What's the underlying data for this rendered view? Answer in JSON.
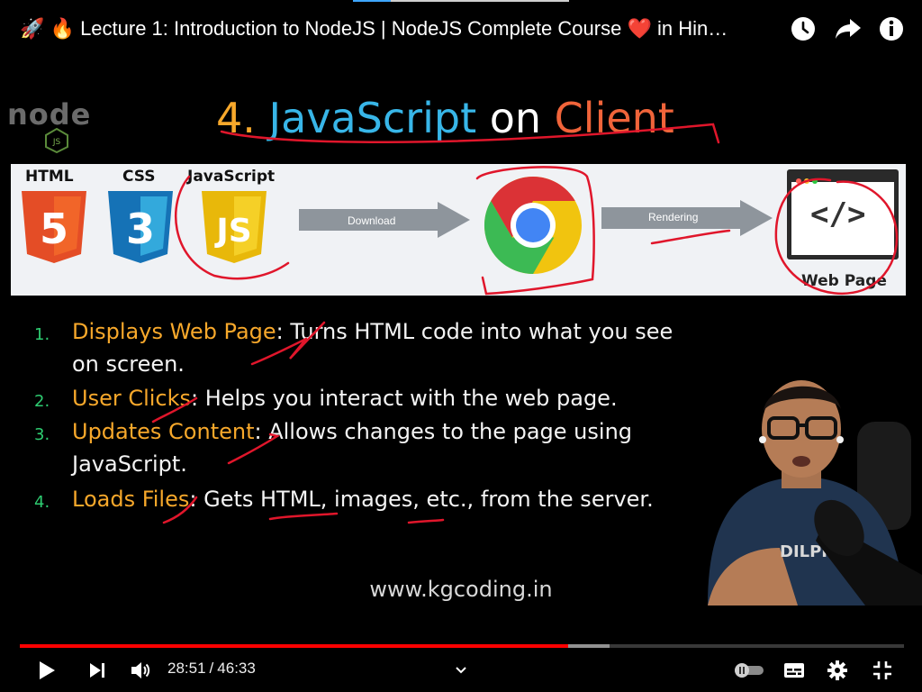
{
  "header": {
    "title_emoji_1": "🚀",
    "title_emoji_2": "🔥",
    "title_part1": "Lecture 1: Introduction to NodeJS | NodeJS Complete Course",
    "title_heart": "❤️",
    "title_part2": "in Hin…",
    "icons": [
      "clock-icon",
      "share-icon",
      "info-icon"
    ]
  },
  "video": {
    "logo_text": "node",
    "logo_sub": "JS",
    "slide_title": {
      "number": "4.",
      "word_js": "JavaScript",
      "word_on": "on",
      "word_client": "Client"
    },
    "diagram": {
      "html_label": "HTML",
      "css_label": "CSS",
      "js_label": "JavaScript",
      "html_glyph": "5",
      "css_glyph": "3",
      "js_glyph": "JS",
      "download_label": "Download",
      "rendering_label": "Rendering",
      "code_glyph": "</>",
      "webpage_label": "Web Page"
    },
    "points": [
      {
        "num": "1.",
        "highlight": "Displays Web Page",
        "rest": ": Turns HTML code into what you see on screen."
      },
      {
        "num": "2.",
        "highlight": "User Clicks",
        "rest": ": Helps you interact with the web page."
      },
      {
        "num": "3.",
        "highlight": "Updates Content",
        "rest": ": Allows changes to the page using JavaScript."
      },
      {
        "num": "4.",
        "highlight": "Loads Files",
        "rest": ": Gets HTML, images, etc., from the server."
      }
    ],
    "presenter_shirt_text": "DILPR",
    "website": "www.kgcoding.in"
  },
  "player": {
    "progress_played": 0.6198,
    "progress_buffered": 0.667,
    "current_time": "28:51",
    "separator": "/",
    "duration": "46:33",
    "colors": {
      "played": "#ff0000",
      "accent_orange": "#f7a82b",
      "accent_blue": "#38b6e8",
      "accent_red": "#f0643a",
      "number_green": "#2ecc71"
    }
  }
}
